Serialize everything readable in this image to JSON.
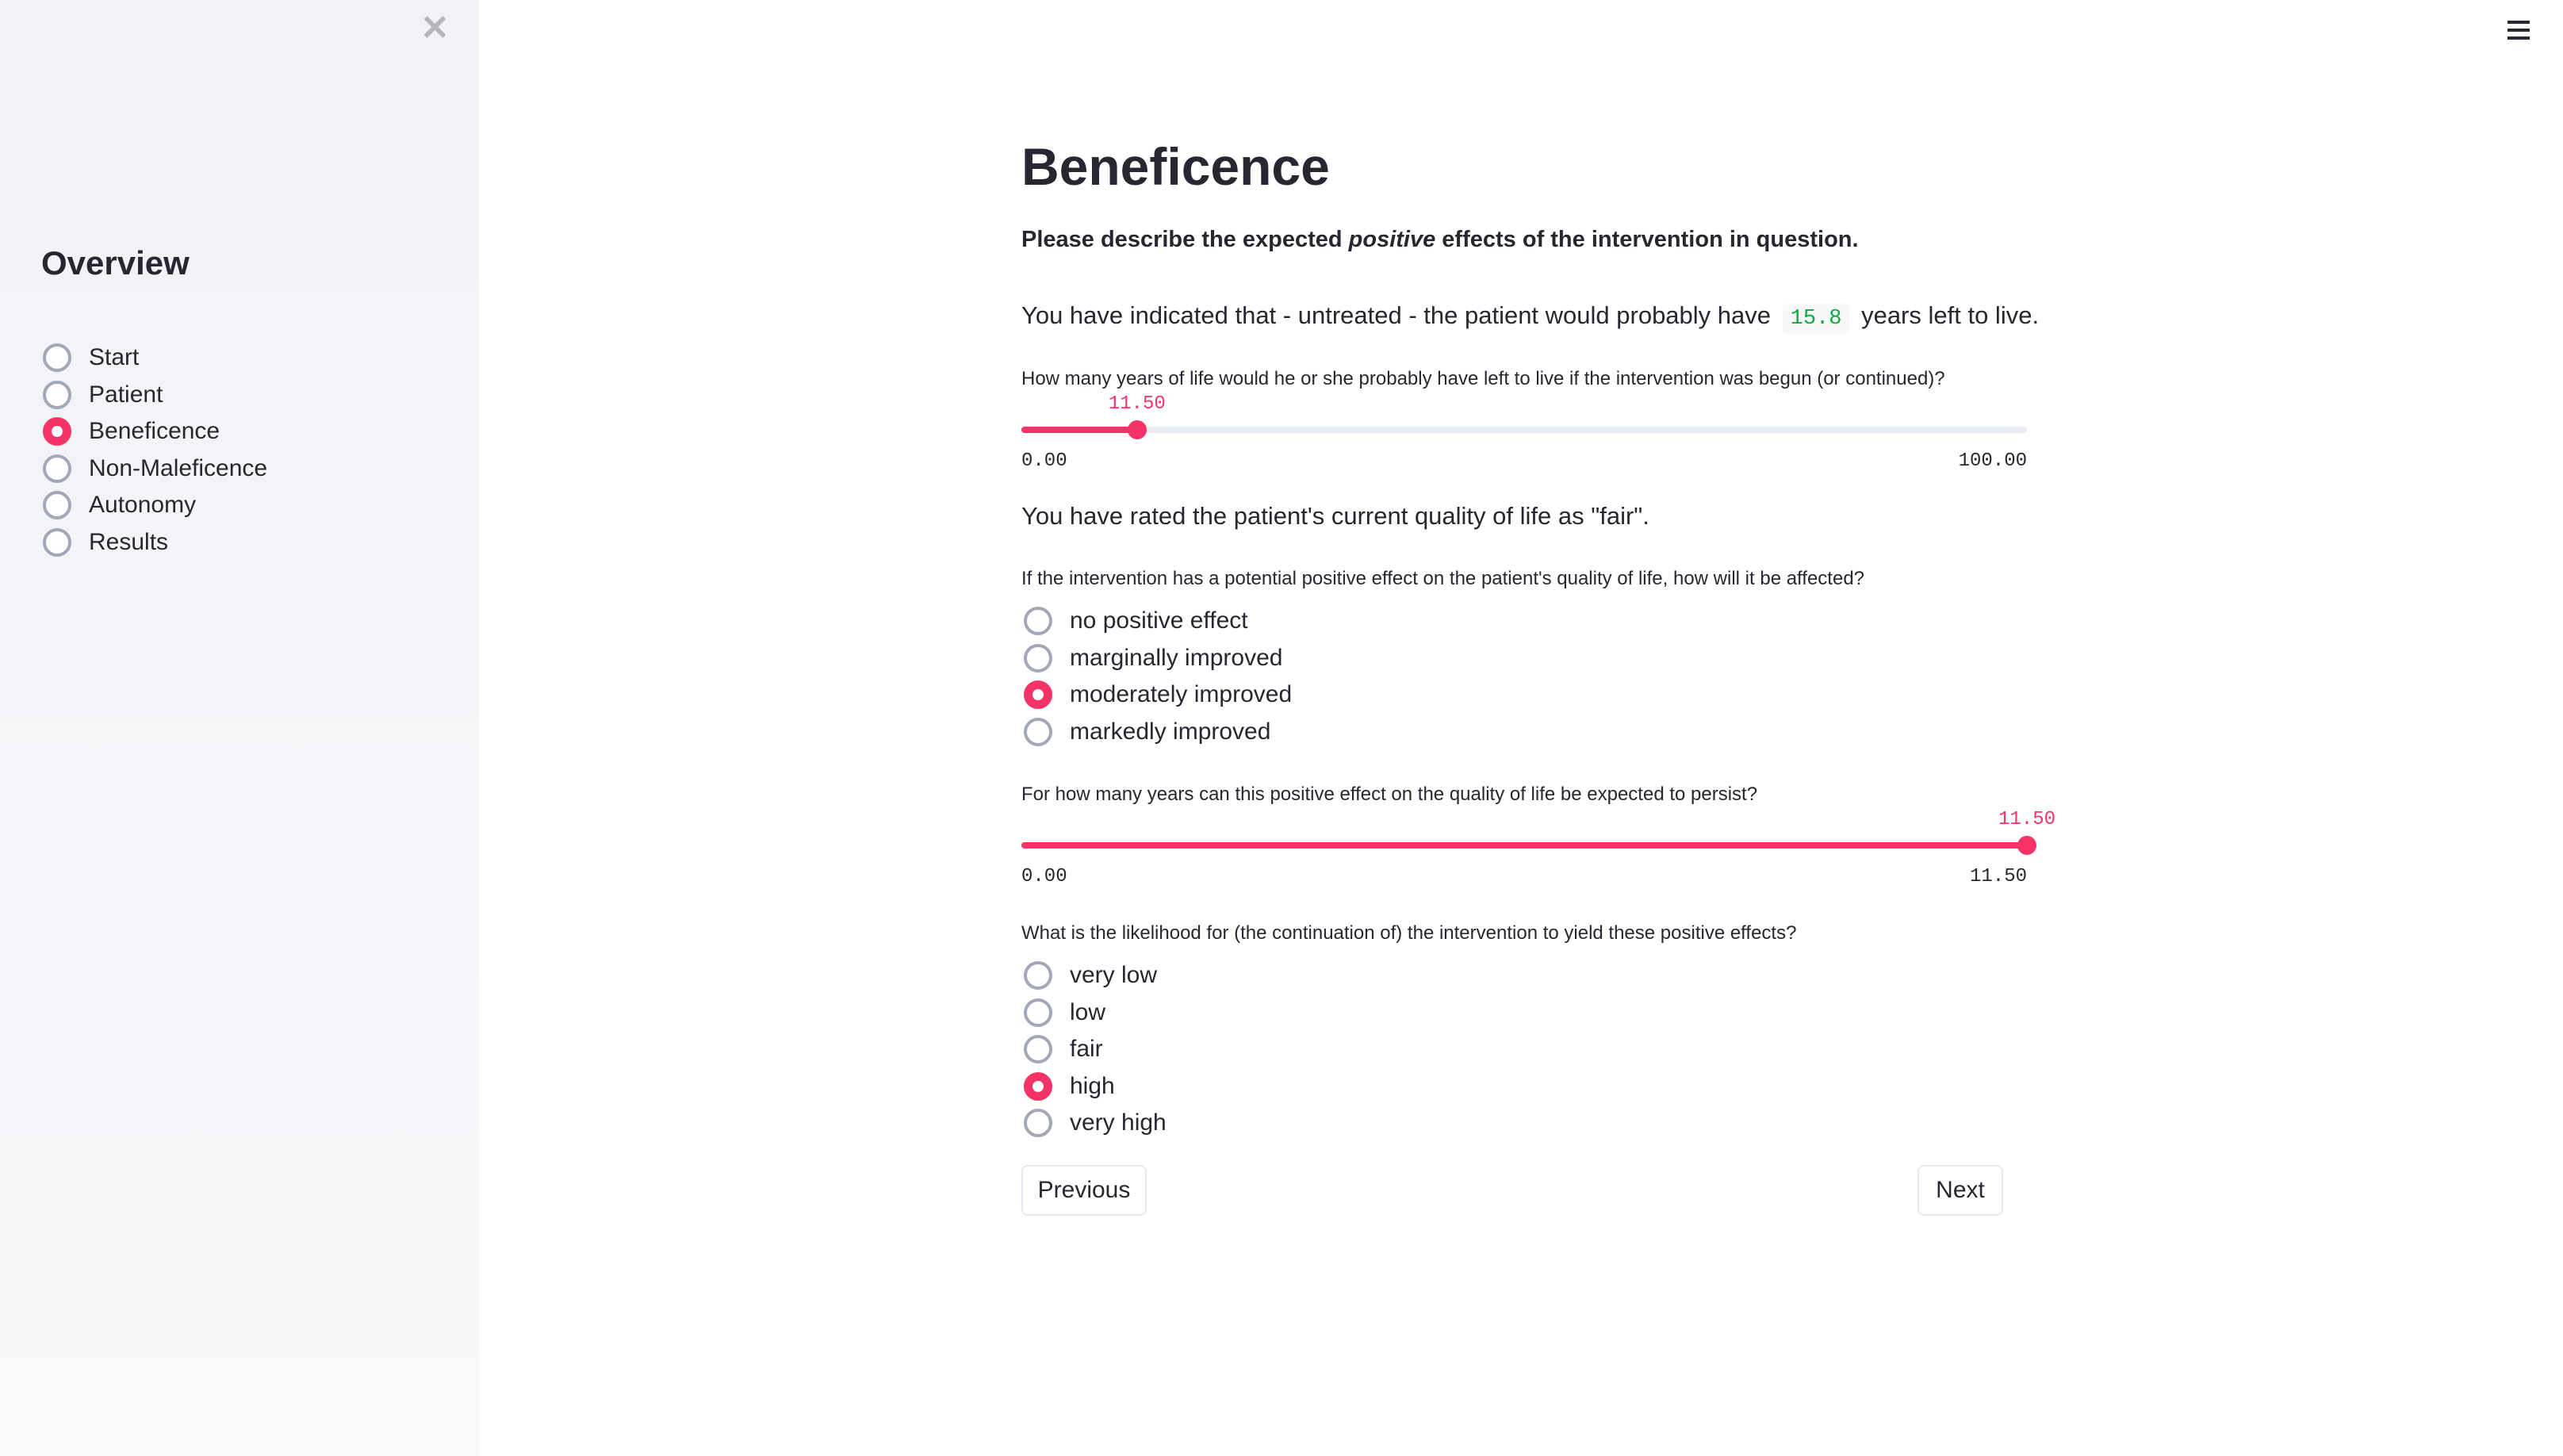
{
  "sidebar": {
    "title": "Overview",
    "items": [
      {
        "label": "Start",
        "selected": false
      },
      {
        "label": "Patient",
        "selected": false
      },
      {
        "label": "Beneficence",
        "selected": true
      },
      {
        "label": "Non-Maleficence",
        "selected": false
      },
      {
        "label": "Autonomy",
        "selected": false
      },
      {
        "label": "Results",
        "selected": false
      }
    ]
  },
  "main": {
    "title": "Beneficence",
    "subtitle_pre": "Please describe the expected ",
    "subtitle_em": "positive",
    "subtitle_post": " effects of the intervention in question.",
    "untreated_pre": "You have indicated that - untreated - the patient would probably have",
    "untreated_value": "15.8",
    "untreated_post": "years left to live.",
    "slider1": {
      "label": "How many years of life would he or she probably have left to live if the intervention was begun (or continued)?",
      "value": "11.50",
      "min": "0.00",
      "max": "100.00",
      "fraction": 0.115
    },
    "rated_text": "You have rated the patient's current quality of life as \"fair\".",
    "q2": {
      "label": "If the intervention has a potential positive effect on the patient's quality of life, how will it be affected?",
      "options": [
        "no positive effect",
        "marginally improved",
        "moderately improved",
        "markedly improved"
      ],
      "selected": 2
    },
    "slider2": {
      "label": "For how many years can this positive effect on the quality of life be expected to persist?",
      "value": "11.50",
      "min": "0.00",
      "max": "11.50",
      "fraction": 1.0
    },
    "q4": {
      "label": "What is the likelihood for (the continuation of) the intervention to yield these positive effects?",
      "options": [
        "very low",
        "low",
        "fair",
        "high",
        "very high"
      ],
      "selected": 3
    },
    "previous_label": "Previous",
    "next_label": "Next"
  },
  "colors": {
    "accent": "#f63366",
    "code": "#09ab3b",
    "sidebar_bg": "#f0f2f6"
  }
}
